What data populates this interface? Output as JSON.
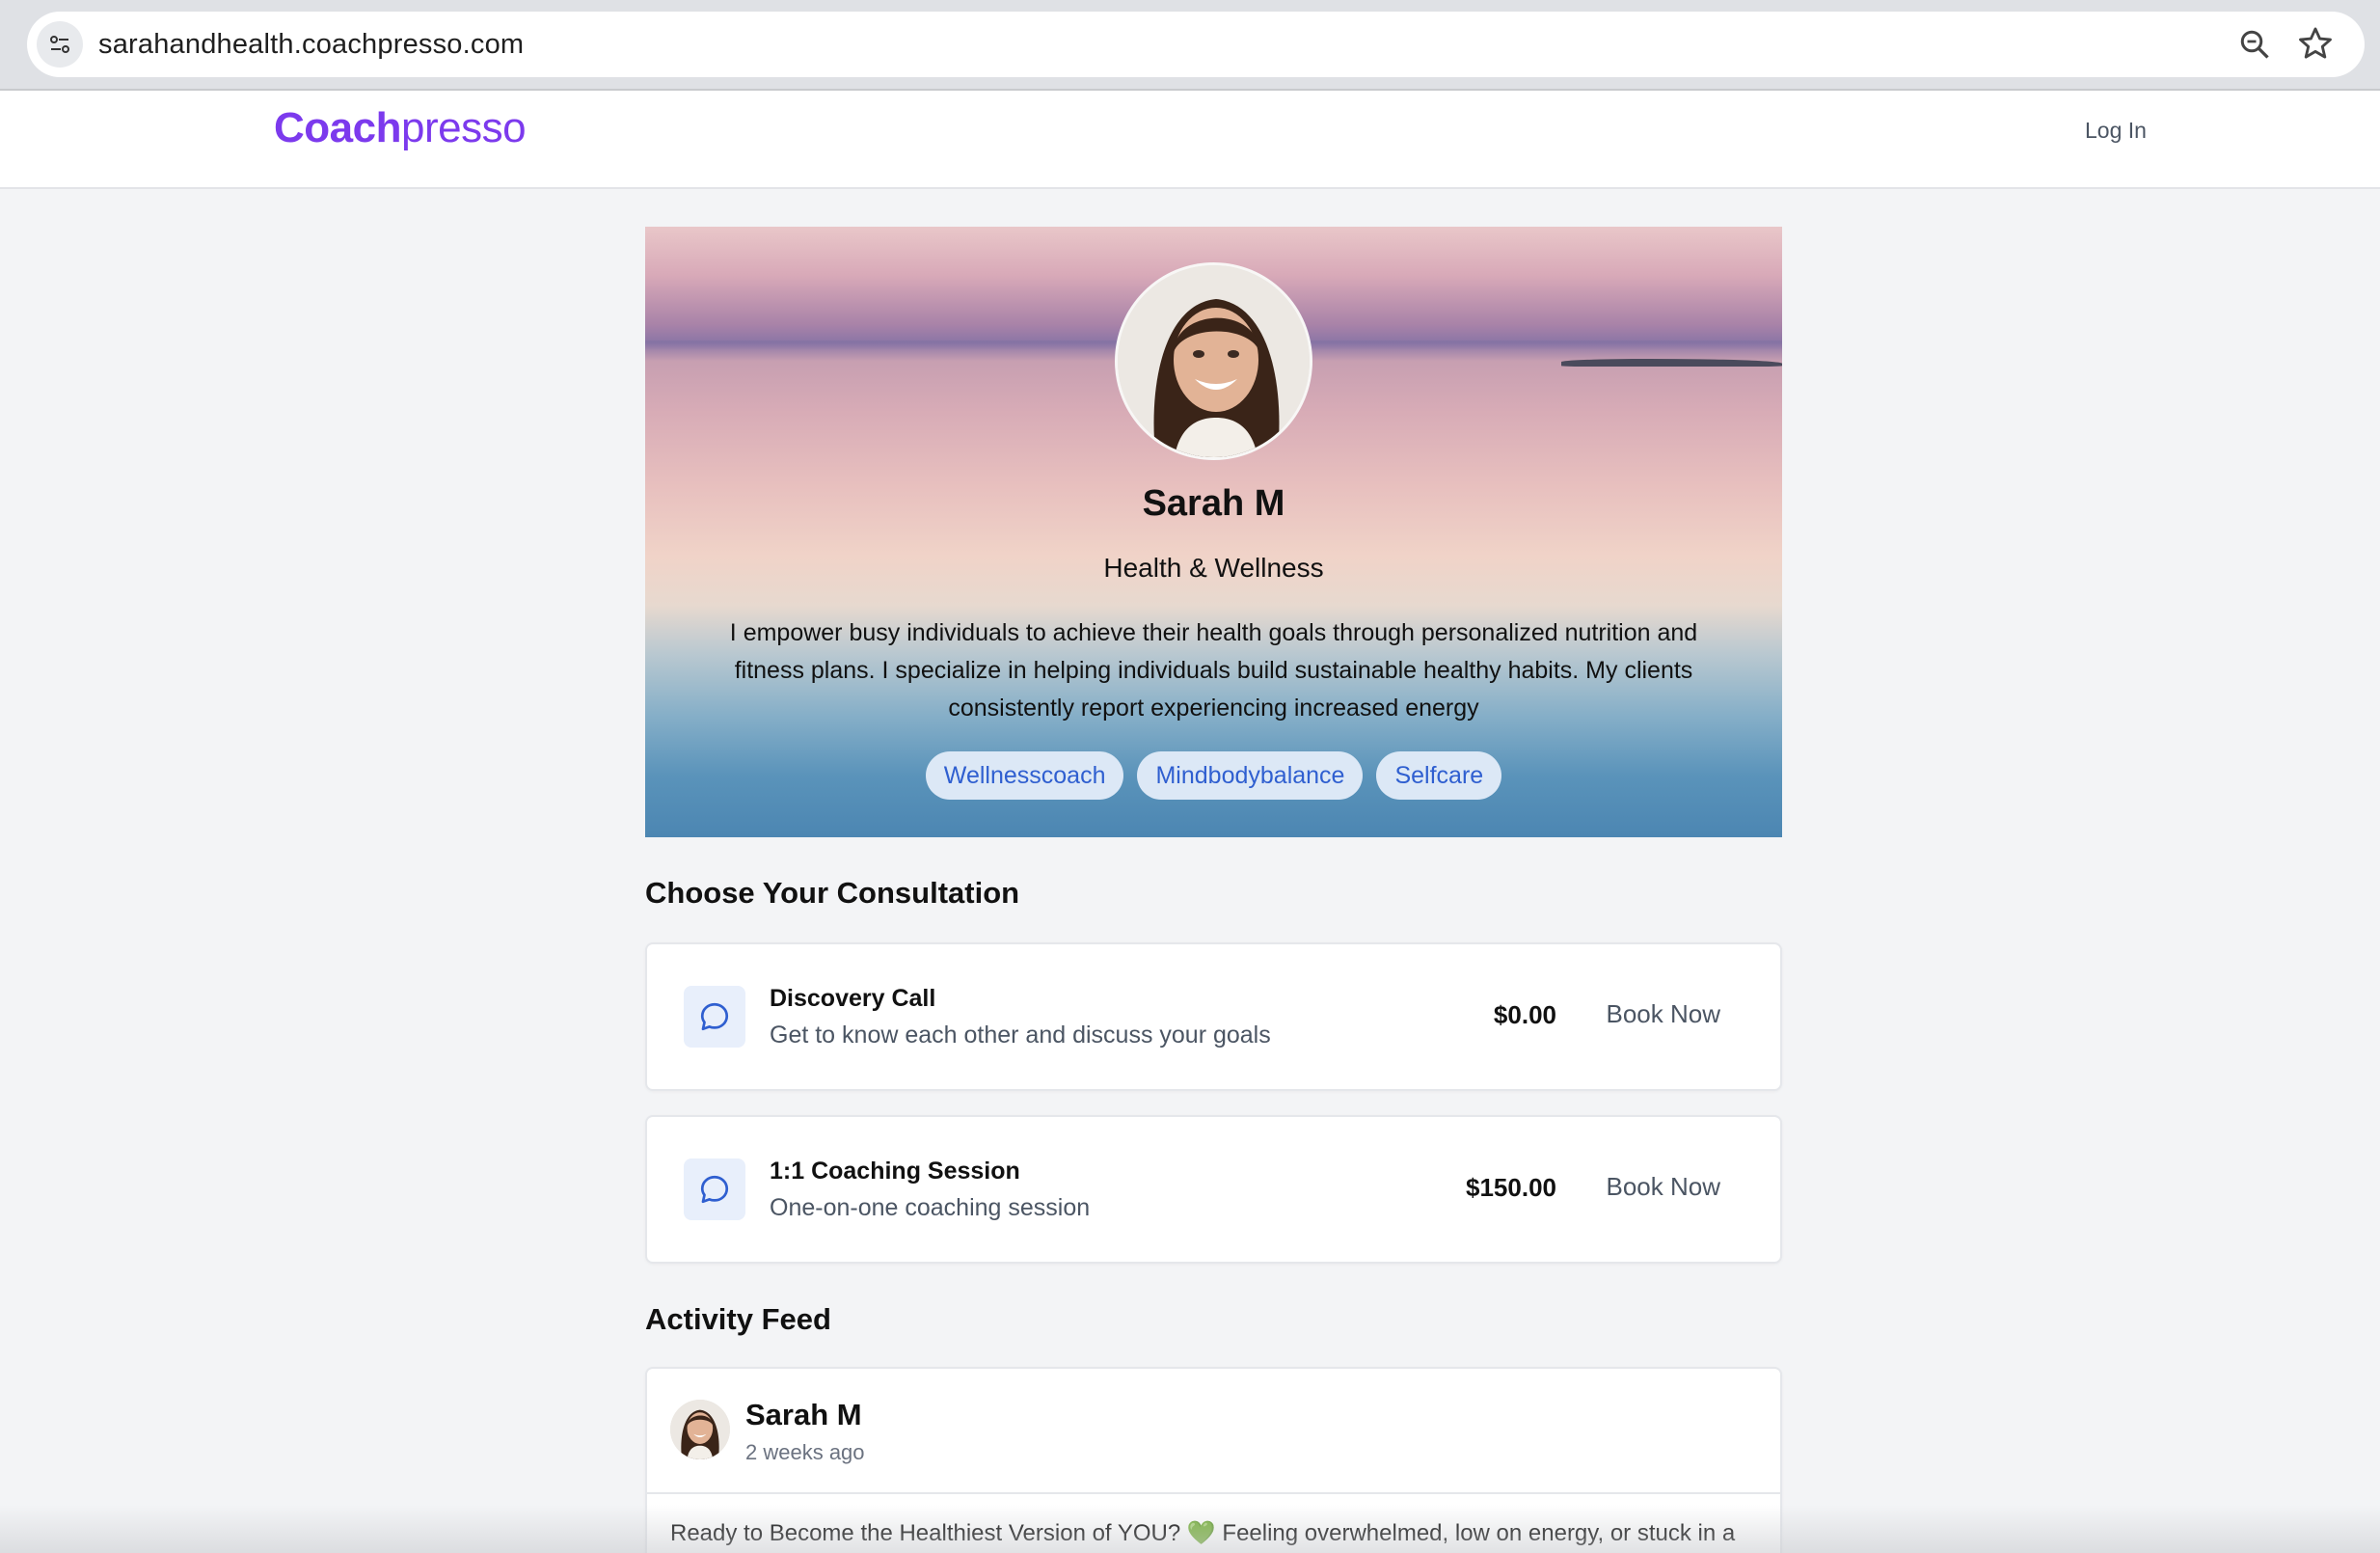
{
  "browser": {
    "url": "sarahandhealth.coachpresso.com",
    "icons": [
      "site-info-icon",
      "zoom-icon",
      "bookmark-star-icon"
    ]
  },
  "header": {
    "logo_bold": "Coach",
    "logo_light": "presso",
    "login_label": "Log In",
    "brand_color": "#7c3aed"
  },
  "profile": {
    "name": "Sarah M",
    "title": "Health & Wellness",
    "bio": "I empower busy individuals to achieve their health goals through personalized nutrition and fitness plans. I specialize in helping individuals build sustainable healthy habits. My clients consistently report experiencing increased energy",
    "tags": [
      "Wellnesscoach",
      "Mindbodybalance",
      "Selfcare"
    ]
  },
  "consultations": {
    "heading": "Choose Your Consultation",
    "items": [
      {
        "title": "Discovery Call",
        "description": "Get to know each other and discuss your goals",
        "price": "$0.00",
        "action": "Book Now",
        "icon": "chat-bubble-icon"
      },
      {
        "title": "1:1 Coaching Session",
        "description": "One-on-one coaching session",
        "price": "$150.00",
        "action": "Book Now",
        "icon": "chat-bubble-icon"
      }
    ]
  },
  "feed": {
    "heading": "Activity Feed",
    "posts": [
      {
        "author": "Sarah M",
        "time": "2 weeks ago",
        "body": "Ready to Become the Healthiest Version of YOU? 💚 Feeling overwhelmed, low on energy, or stuck in a"
      }
    ]
  }
}
